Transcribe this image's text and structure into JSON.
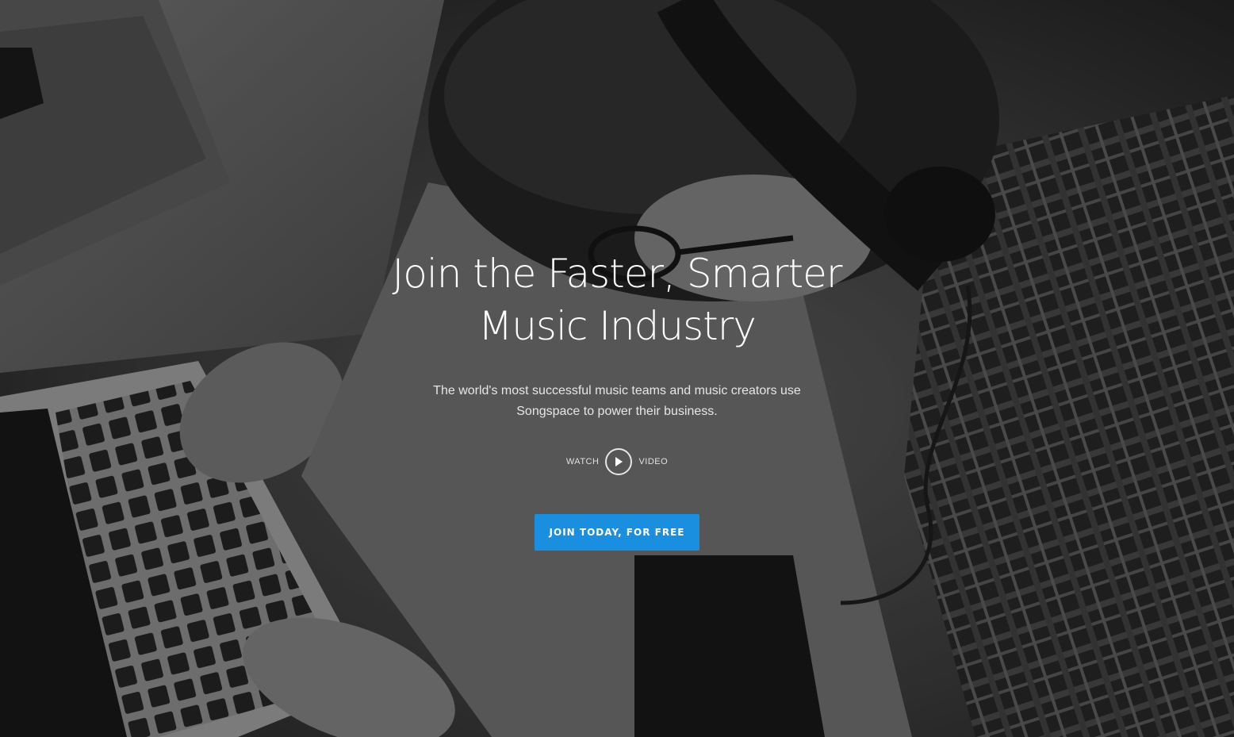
{
  "hero": {
    "headline_line1": "Join the Faster, Smarter",
    "headline_line2": "Music Industry",
    "subhead_line1": "The world's most successful music teams and music creators use",
    "subhead_line2": "Songspace to power their business.",
    "watch_label": "WATCH",
    "video_label": "VIDEO",
    "play_icon": "play-icon",
    "cta_label": "JOIN TODAY, FOR FREE"
  },
  "colors": {
    "cta_background": "#1a8fe0",
    "text": "#ffffff"
  }
}
